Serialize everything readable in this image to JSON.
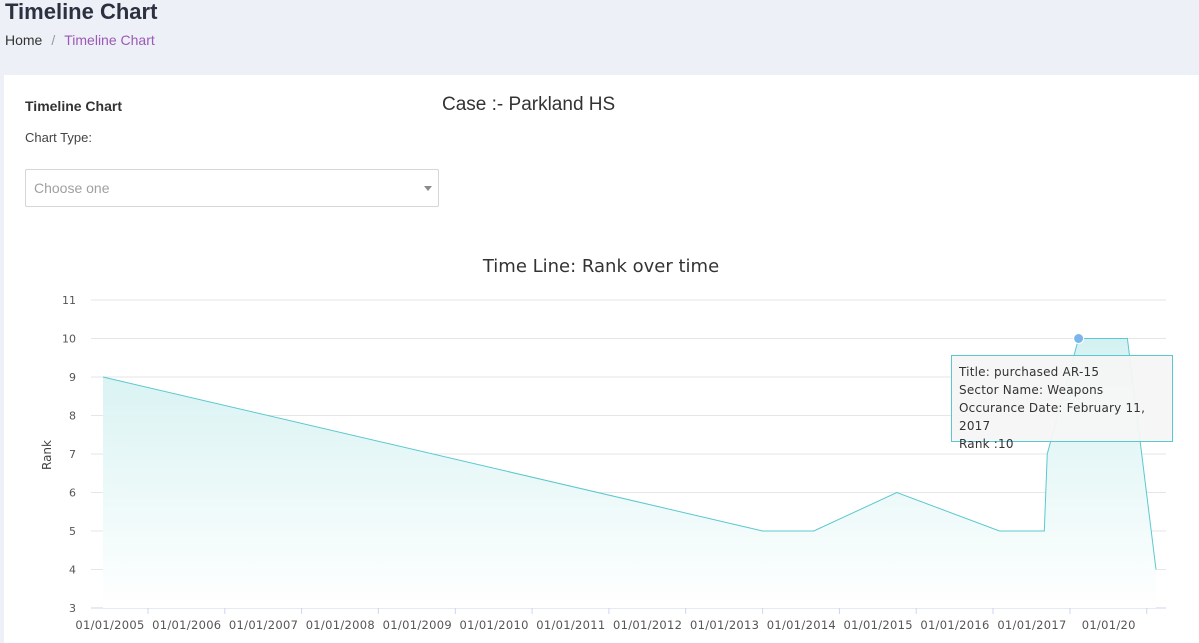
{
  "header": {
    "title": "Timeline Chart",
    "breadcrumb": {
      "home": "Home",
      "separator": "/",
      "current": "Timeline Chart"
    }
  },
  "panel": {
    "title": "Timeline Chart",
    "chart_type_label": "Chart Type:",
    "chart_type_select": {
      "placeholder": "Choose one",
      "value": ""
    }
  },
  "case_title": "Case :- Parkland HS",
  "chart_data": {
    "type": "area",
    "title": "Time Line: Rank over time",
    "xlabel": "",
    "ylabel": "Rank",
    "ylim": [
      3,
      11
    ],
    "y_ticks": [
      3,
      4,
      5,
      6,
      7,
      8,
      9,
      10,
      11
    ],
    "x_tick_labels": [
      "01/01/2005",
      "01/01/2006",
      "01/01/2007",
      "01/01/2008",
      "01/01/2009",
      "01/01/2010",
      "01/01/2011",
      "01/01/2012",
      "01/01/2013",
      "01/01/2014",
      "01/01/2015",
      "01/01/2016",
      "01/01/2017",
      "01/01/20"
    ],
    "grid": true,
    "series": [
      {
        "points": [
          {
            "x": "2004-06-01",
            "y": 9
          },
          {
            "x": "2013-01-01",
            "y": 5
          },
          {
            "x": "2013-09-01",
            "y": 5
          },
          {
            "x": "2014-10-01",
            "y": 6
          },
          {
            "x": "2016-02-01",
            "y": 5
          },
          {
            "x": "2016-09-01",
            "y": 5
          },
          {
            "x": "2016-09-15",
            "y": 7
          },
          {
            "x": "2017-02-11",
            "y": 10
          },
          {
            "x": "2017-10-01",
            "y": 10
          },
          {
            "x": "2018-02-14",
            "y": 4
          }
        ]
      }
    ],
    "colors": {
      "line": "#5bc8cf",
      "fill_top": "#d4f1f1",
      "fill_bottom": "#ffffff",
      "highlight": "#7cb5ec"
    },
    "highlighted_point": {
      "x": "2017-02-11",
      "y": 10
    },
    "tooltip": {
      "title": "Title: purchased AR-15",
      "sector": "Sector Name: Weapons",
      "date": "Occurance Date: February 11, 2017",
      "rank": "Rank :10"
    }
  }
}
